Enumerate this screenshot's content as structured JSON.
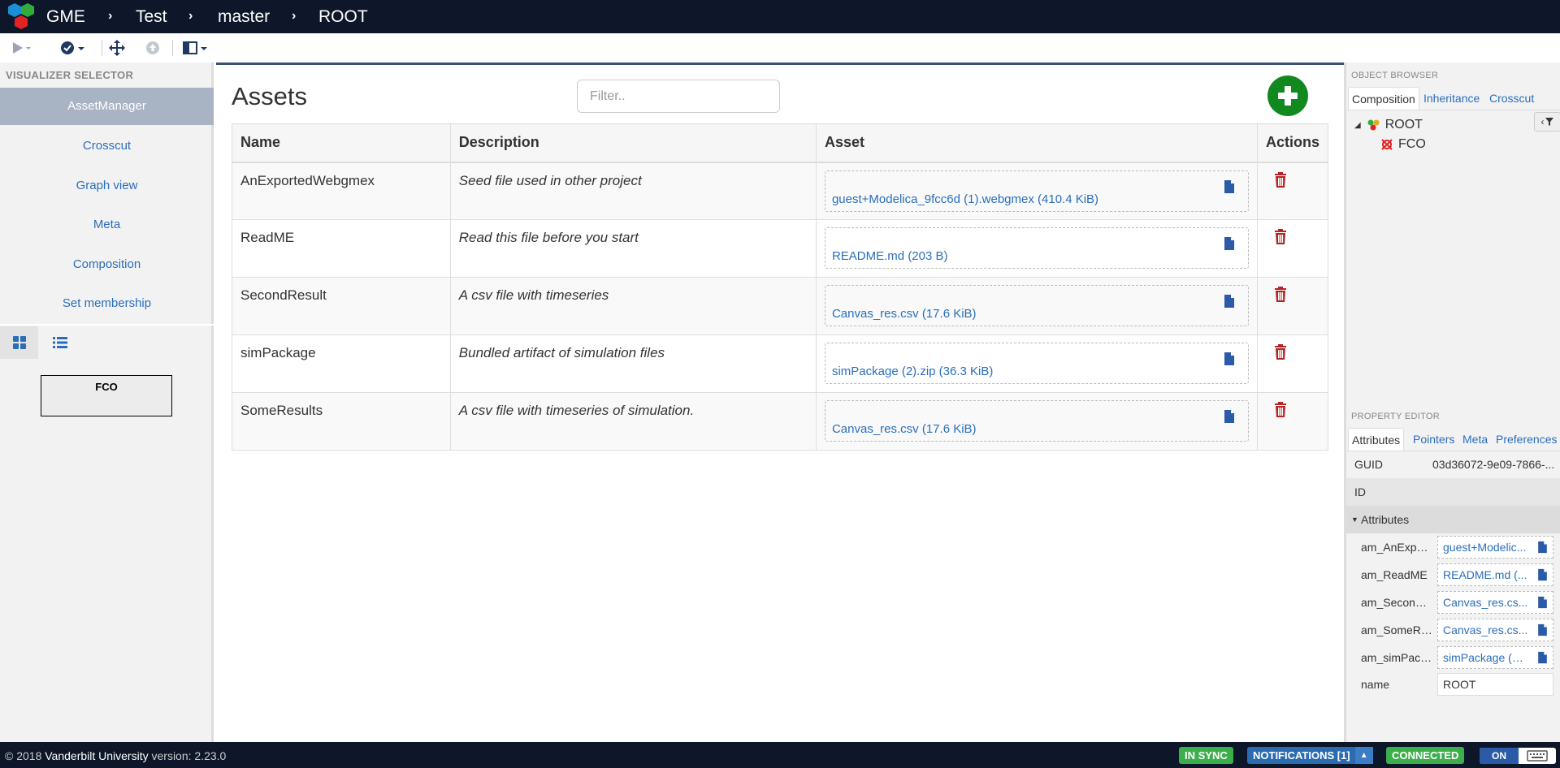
{
  "breadcrumb": {
    "app": "GME",
    "project": "Test",
    "branch": "master",
    "node": "ROOT"
  },
  "visualizer_selector": {
    "title": "VISUALIZER SELECTOR",
    "items": [
      {
        "label": "AssetManager",
        "active": true
      },
      {
        "label": "Crosscut",
        "active": false
      },
      {
        "label": "Graph view",
        "active": false
      },
      {
        "label": "Meta",
        "active": false
      },
      {
        "label": "Composition",
        "active": false
      },
      {
        "label": "Set membership",
        "active": false
      }
    ],
    "fco_label": "FCO"
  },
  "main": {
    "title": "Assets",
    "filter_placeholder": "Filter..",
    "columns": [
      "Name",
      "Description",
      "Asset",
      "Actions"
    ],
    "rows": [
      {
        "name": "AnExportedWebgmex",
        "description": "Seed file used in other project",
        "asset": "guest+Modelica_9fcc6d (1).webgmex (410.4 KiB)"
      },
      {
        "name": "ReadME",
        "description": "Read this file before you start",
        "asset": "README.md (203 B)"
      },
      {
        "name": "SecondResult",
        "description": "A csv file with timeseries",
        "asset": "Canvas_res.csv (17.6 KiB)"
      },
      {
        "name": "simPackage",
        "description": "Bundled artifact of simulation files",
        "asset": "simPackage (2).zip (36.3 KiB)"
      },
      {
        "name": "SomeResults",
        "description": "A csv file with timeseries of simulation.",
        "asset": "Canvas_res.csv (17.6 KiB)"
      }
    ]
  },
  "object_browser": {
    "title": "OBJECT BROWSER",
    "tabs": [
      "Composition",
      "Inheritance",
      "Crosscut"
    ],
    "tree": {
      "root": "ROOT",
      "child": "FCO"
    }
  },
  "property_editor": {
    "title": "PROPERTY EDITOR",
    "tabs": [
      "Attributes",
      "Pointers",
      "Meta",
      "Preferences"
    ],
    "guid_label": "GUID",
    "guid_value": "03d36072-9e09-7866-...",
    "id_label": "ID",
    "group_label": "Attributes",
    "attributes": [
      {
        "key": "am_AnExport...",
        "value": "guest+Modelic..."
      },
      {
        "key": "am_ReadME",
        "value": "README.md (..."
      },
      {
        "key": "am_SecondR...",
        "value": "Canvas_res.cs..."
      },
      {
        "key": "am_SomeRe...",
        "value": "Canvas_res.cs..."
      },
      {
        "key": "am_simPack...",
        "value": "simPackage (2)..."
      }
    ],
    "name_label": "name",
    "name_value": "ROOT"
  },
  "footer": {
    "copyright_prefix": "© 2018",
    "org": "Vanderbilt University",
    "version_label": "version:",
    "version": "2.23.0",
    "status_sync": "IN SYNC",
    "status_notifications": "NOTIFICATIONS [1]",
    "status_connected": "CONNECTED",
    "toggle_on": "ON"
  },
  "colors": {
    "nav_bg": "#0d1729",
    "link": "#2a6ebb",
    "add_button": "#11891f",
    "trash": "#b32424",
    "in_sync": "#3cae4b",
    "notifications": "#2b6cb0",
    "connected": "#3cae4b"
  }
}
